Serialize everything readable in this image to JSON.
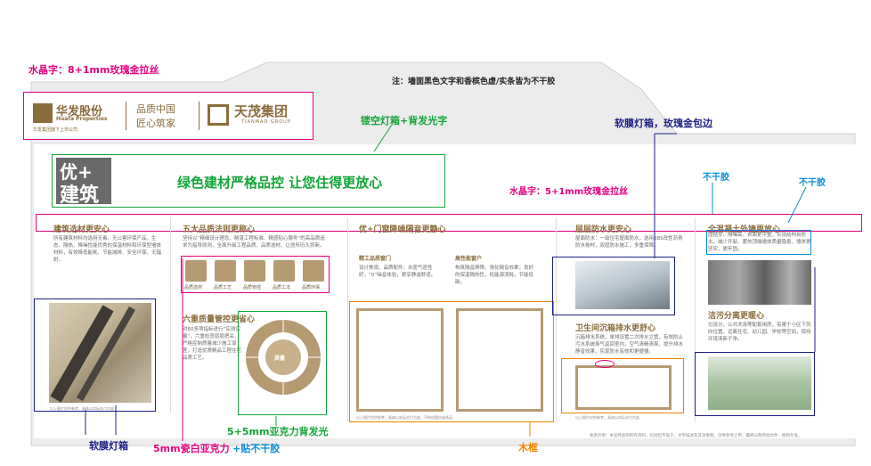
{
  "annotations": {
    "crystal_top": "水晶字：8+1mm玫瑰金拉丝",
    "note": "注：墙面黑色文字和香槟色虚/实条皆为不干胶",
    "hollow_lightbox": "镂空灯箱+背发光字",
    "soft_film_right": "软膜灯箱，玫瑰金包边",
    "not_dry_1": "不干胶",
    "not_dry_2": "不干胶",
    "crystal_mid": "水晶字：5+1mm玫瑰金拉丝",
    "soft_film_bottom": "软膜灯箱",
    "acrylic_white": "5mm瓷白亚克力",
    "acrylic_white_suffix": "+贴不干胶",
    "acrylic_backlight": "5+5mm亚克力背发光",
    "wood_frame": "木框"
  },
  "logos": {
    "huafa_name": "华发股份",
    "huafa_en": "Huafa Properties",
    "huafa_sub": "华发集团旗下上市公司",
    "slogan_line1": "品质中国",
    "slogan_line2": "匠心筑家",
    "tianmao_name": "天茂集团",
    "tianmao_en": "TIANMAO GROUP"
  },
  "hero": {
    "badge_line1": "优+",
    "badge_line2": "建筑",
    "headline": "绿色建材严格品控 让您住得更放心"
  },
  "columns": {
    "c1": {
      "title": "建筑选材更安心",
      "text": "所有建筑材料均选用无毒、无公害环保产品，生态、隔热、降噪性能优秀的保温材料和环保型墙体材料，有效降低能耗，节能减排、安全环保、无辐射。",
      "caption": "以上图片仅供参考，具体以实际交付为准"
    },
    "c2": {
      "title": "五大品质法则更称心",
      "text": "坚持以“精细设计理念、精湛工程标准、精感贴心服务”的高品质追求为指导原则，全面升级工程品质、品质选材、让居所历久弥新。",
      "icons": [
        "品质选材",
        "品质工艺",
        "品质管控",
        "品质工法",
        "品质环保"
      ],
      "title2": "六重质量管控更省心",
      "text2": "对60多项指标进行“实测实量”，六重检查层层把关，严格控制质量减少施工误差，打造优质精品工程住宅品质工艺。",
      "wheel_center": "质量"
    },
    "c3": {
      "title": "优+门窗降噪隔音更静心",
      "sub1": "精工品质窗门",
      "text1": "设计美观、品质配件、水密气密性好，“0”噪音体验，更享静谧舒适。",
      "sub2": "高性能窗户",
      "text2": "构筑隔音屏障，强化隔音效果；良好的保温隔热性，低能源消耗，节能低碳。",
      "caption": "以上图片仅供参考，具体以实际交付为准，不构成要约或承诺"
    },
    "c4": {
      "title": "层层防水更安心",
      "text": "屋面防水：一级住宅屋面防水，选用SBS改性沥青防水卷材，双层防水施工，多重保障。",
      "title2": "卫生间沉箱排水更舒心",
      "text2": "沉箱排水系统，单排设置二次排水立管，有效防止污水系统臭气返回室内，空气清畅清爽，提升排水静音效果，实现防水有效和更便捷。",
      "caption": "以上图片仅供参考，具体以实际交付为准"
    },
    "c5": {
      "title": "全混凝土外墙更放心",
      "text": "固结安、隔噪高、表面更平整，实现结构自防水，减少开裂、蓄热顶端墙体质量隐患，墙体更坚实，更牢固。",
      "title2": "洁污分离更暖心",
      "text2": "垃圾分、公共洗涤等配套用房，有害于小区下风向位置，远离住宅、幼儿园、学校等空间，保持环境清新干净。"
    },
    "footer_note": "免责声明：本宣传品的所有资料，包括但不限于，文字描述及其效果图，仅供参考之用，最终以政府批文件、图则为准。"
  }
}
